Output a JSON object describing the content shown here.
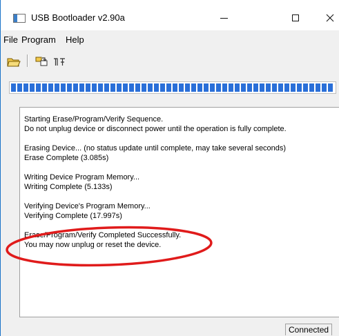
{
  "window": {
    "title": "USB Bootloader v2.90a",
    "controls": {
      "minimize": "minimize-icon",
      "maximize": "maximize-icon",
      "close": "close-icon"
    }
  },
  "menu": [
    "File",
    "Program",
    "Help"
  ],
  "toolbar": {
    "icons": [
      "open-folder-icon",
      "program-device-icon",
      "reset-device-icon"
    ]
  },
  "progress": {
    "value": 1.0,
    "color": "#2a6fd8"
  },
  "log": [
    "Starting Erase/Program/Verify Sequence.",
    "Do not unplug device or disconnect power until the operation is fully complete.",
    "Erasing Device... (no status update until complete, may take several seconds)",
    "Erase Complete (3.085s)",
    "Writing Device Program Memory...",
    "Writing Complete (5.133s)",
    "Verifying Device's Program Memory...",
    "Verifying Complete (17.997s)",
    "Erase/Program/Verify Completed Successfully.",
    "You may now unplug or reset the device."
  ],
  "status": {
    "text": "Connected"
  },
  "annotation": {
    "shape": "ellipse",
    "color": "#e01b1b"
  }
}
